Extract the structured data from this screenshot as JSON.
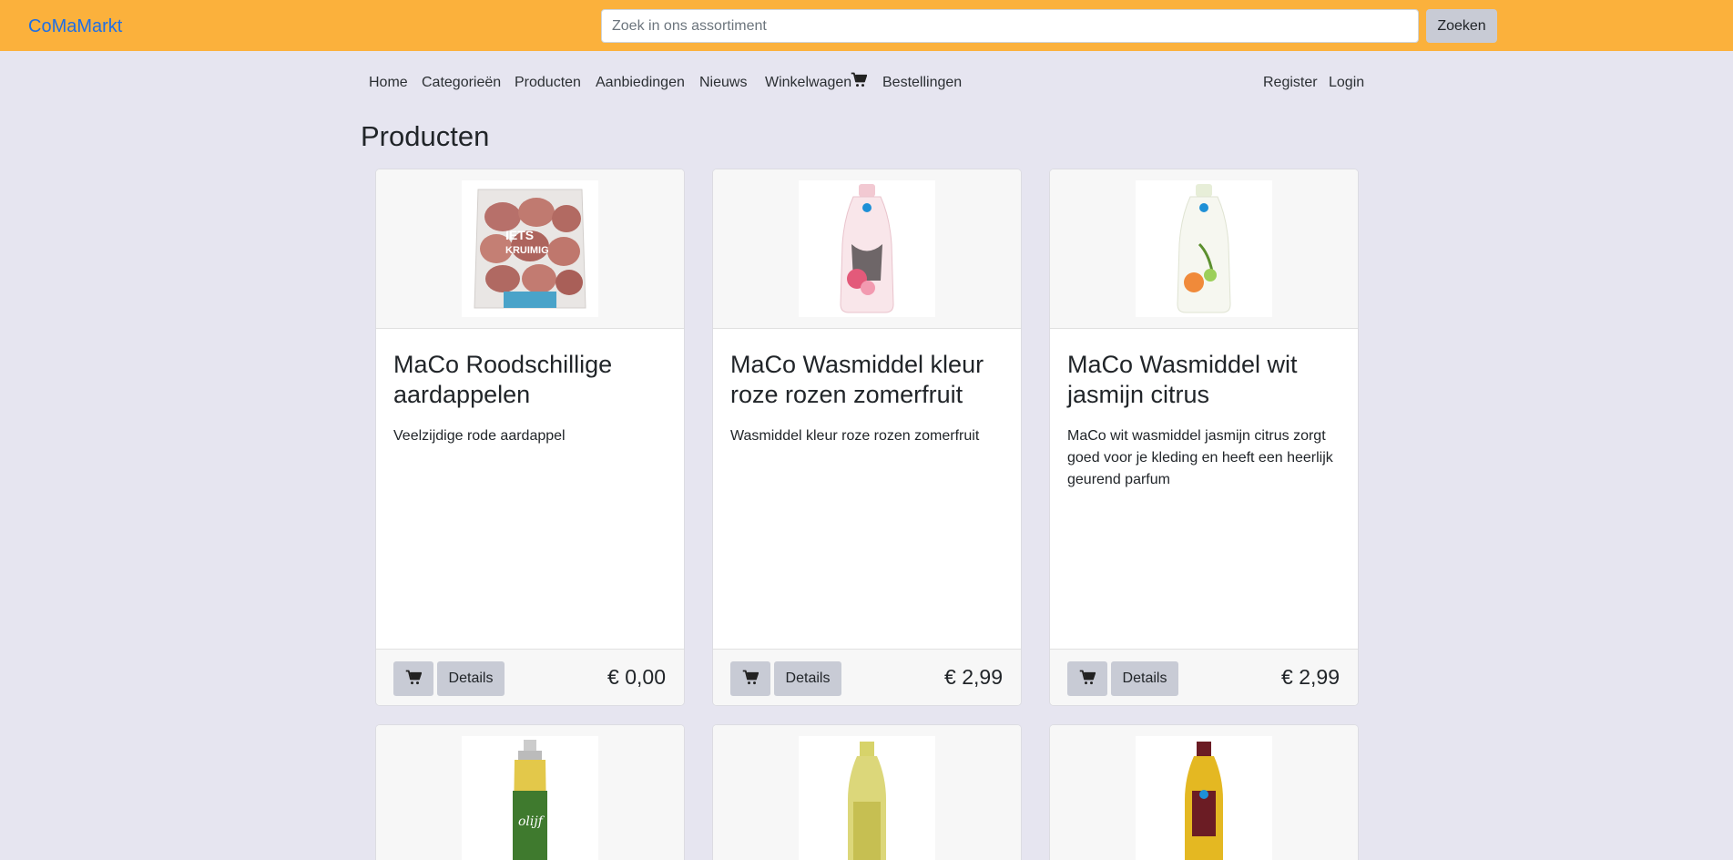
{
  "header": {
    "brand": "CoMaMarkt",
    "search": {
      "placeholder": "Zoek in ons assortiment",
      "value": "",
      "button_label": "Zoeken"
    }
  },
  "nav": {
    "items": [
      "Home",
      "Categorieën",
      "Producten",
      "Aanbiedingen",
      "Nieuws",
      "Winkelwagen",
      "Bestellingen"
    ],
    "right_items": [
      "Register",
      "Login"
    ],
    "cart_icon": "shopping-cart-icon"
  },
  "page": {
    "title": "Producten"
  },
  "products": [
    {
      "name": "MaCo Roodschillige aardappelen",
      "description": "Veelzijdige rode aardappel",
      "price": "€ 0,00",
      "details_label": "Details",
      "image": "potatoes-bag"
    },
    {
      "name": "MaCo Wasmiddel kleur roze rozen zomerfruit",
      "description": "Wasmiddel kleur roze rozen zomerfruit",
      "price": "€ 2,99",
      "details_label": "Details",
      "image": "detergent-bottle-pink"
    },
    {
      "name": "MaCo Wasmiddel wit jasmijn citrus",
      "description": "MaCo wit wasmiddel jasmijn citrus zorgt goed voor je kleding en heeft een heerlijk geurend parfum",
      "price": "€ 2,99",
      "details_label": "Details",
      "image": "detergent-bottle-white"
    },
    {
      "image": "oil-spray-bottle"
    },
    {
      "image": "olive-oil-bottle"
    },
    {
      "image": "oil-bottle-dark"
    }
  ],
  "colors": {
    "header_bg": "#fbb13c",
    "brand": "#1f6fe5",
    "page_bg": "#e6e5f0",
    "button_bg": "#c8cbd5"
  }
}
